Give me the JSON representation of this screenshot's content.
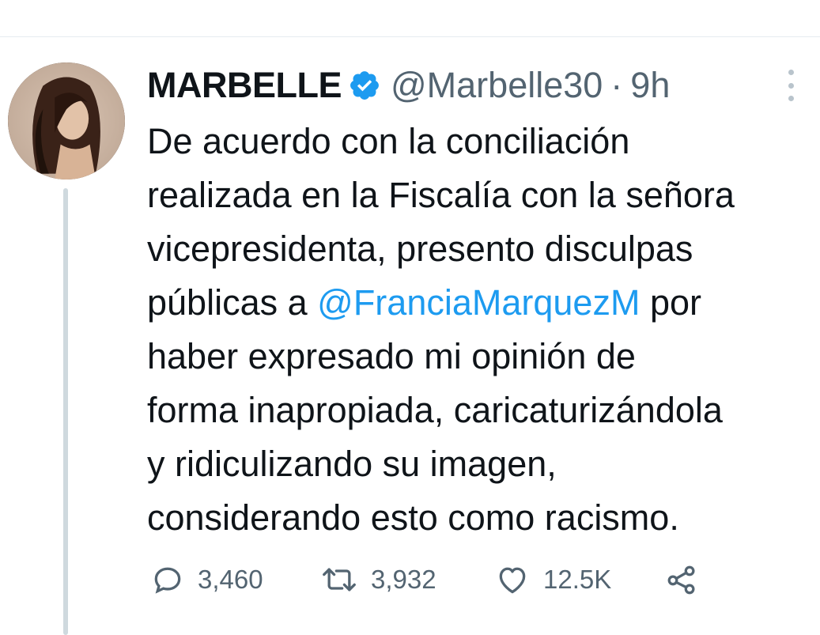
{
  "author": {
    "display_name": "MARBELLE",
    "handle": "@Marbelle30",
    "separator": "·",
    "time": "9h",
    "verified": true
  },
  "tweet": {
    "lines": [
      {
        "text": "De acuerdo con la conciliación"
      },
      {
        "text": "realizada en la Fiscalía con la señora"
      },
      {
        "text": "vicepresidenta, presento disculpas"
      },
      {
        "before": "públicas a ",
        "mention": "@FranciaMarquezM",
        "after": " por"
      },
      {
        "text": "haber expresado mi opinión de"
      },
      {
        "text": "forma inapropiada, caricaturizándola"
      },
      {
        "text": "y ridiculizando su imagen,"
      },
      {
        "text": "considerando esto como racismo."
      }
    ]
  },
  "actions": {
    "replies": "3,460",
    "retweets": "3,932",
    "likes": "12.5K"
  },
  "icons": {
    "reply": "reply-icon",
    "retweet": "retweet-icon",
    "like": "heart-icon",
    "share": "share-icon",
    "verified": "verified-badge-icon",
    "more": "more-options-icon"
  },
  "colors": {
    "text": "#0f1419",
    "secondary": "#536471",
    "mention": "#1d9bf0",
    "verified": "#1d9bf0",
    "divider": "#e6ecf0",
    "thread_line": "#cfd9de"
  }
}
